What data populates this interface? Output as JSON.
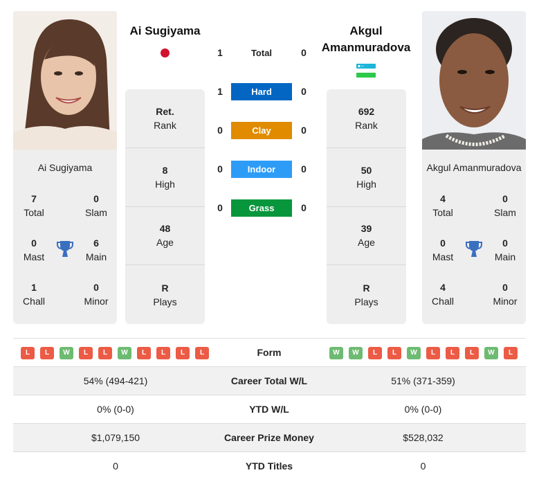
{
  "player1": {
    "name": "Ai Sugiyama",
    "photo_alt": "Ai Sugiyama photo",
    "flag": "japan-flag",
    "card_name": "Ai Sugiyama",
    "titles": {
      "total": {
        "value": "7",
        "label": "Total"
      },
      "slam": {
        "value": "0",
        "label": "Slam"
      },
      "mast": {
        "value": "0",
        "label": "Mast"
      },
      "main": {
        "value": "6",
        "label": "Main"
      },
      "chall": {
        "value": "1",
        "label": "Chall"
      },
      "minor": {
        "value": "0",
        "label": "Minor"
      }
    },
    "stats": [
      {
        "value": "Ret.",
        "label": "Rank"
      },
      {
        "value": "8",
        "label": "High"
      },
      {
        "value": "48",
        "label": "Age"
      },
      {
        "value": "R",
        "label": "Plays"
      }
    ],
    "form": [
      "L",
      "L",
      "W",
      "L",
      "L",
      "W",
      "L",
      "L",
      "L",
      "L"
    ]
  },
  "player2": {
    "name": "Akgul Amanmuradova",
    "name_line1": "Akgul",
    "name_line2": "Amanmuradova",
    "photo_alt": "Akgul Amanmuradova photo",
    "flag": "uzbekistan-flag",
    "card_name": "Akgul Amanmuradova",
    "titles": {
      "total": {
        "value": "4",
        "label": "Total"
      },
      "slam": {
        "value": "0",
        "label": "Slam"
      },
      "mast": {
        "value": "0",
        "label": "Mast"
      },
      "main": {
        "value": "0",
        "label": "Main"
      },
      "chall": {
        "value": "4",
        "label": "Chall"
      },
      "minor": {
        "value": "0",
        "label": "Minor"
      }
    },
    "stats": [
      {
        "value": "692",
        "label": "Rank"
      },
      {
        "value": "50",
        "label": "High"
      },
      {
        "value": "39",
        "label": "Age"
      },
      {
        "value": "R",
        "label": "Plays"
      }
    ],
    "form": [
      "W",
      "W",
      "L",
      "L",
      "W",
      "L",
      "L",
      "L",
      "W",
      "L"
    ]
  },
  "h2h": [
    {
      "surface": "Total",
      "p1": "1",
      "p2": "0",
      "color": ""
    },
    {
      "surface": "Hard",
      "p1": "1",
      "p2": "0",
      "color": "#0366c3"
    },
    {
      "surface": "Clay",
      "p1": "0",
      "p2": "0",
      "color": "#e08b00"
    },
    {
      "surface": "Indoor",
      "p1": "0",
      "p2": "0",
      "color": "#2d9cf7"
    },
    {
      "surface": "Grass",
      "p1": "0",
      "p2": "0",
      "color": "#08963c"
    }
  ],
  "comparison": {
    "form_label": "Form",
    "rows": [
      {
        "label": "Career Total W/L",
        "p1": "54% (494-421)",
        "p2": "51% (371-359)"
      },
      {
        "label": "YTD W/L",
        "p1": "0% (0-0)",
        "p2": "0% (0-0)"
      },
      {
        "label": "Career Prize Money",
        "p1": "$1,079,150",
        "p2": "$528,032"
      },
      {
        "label": "YTD Titles",
        "p1": "0",
        "p2": "0"
      }
    ]
  },
  "colors": {
    "win": "#6dbb72",
    "loss": "#ec5b45",
    "trophy": "#3a6fc0",
    "card_bg": "#eeeeee"
  }
}
